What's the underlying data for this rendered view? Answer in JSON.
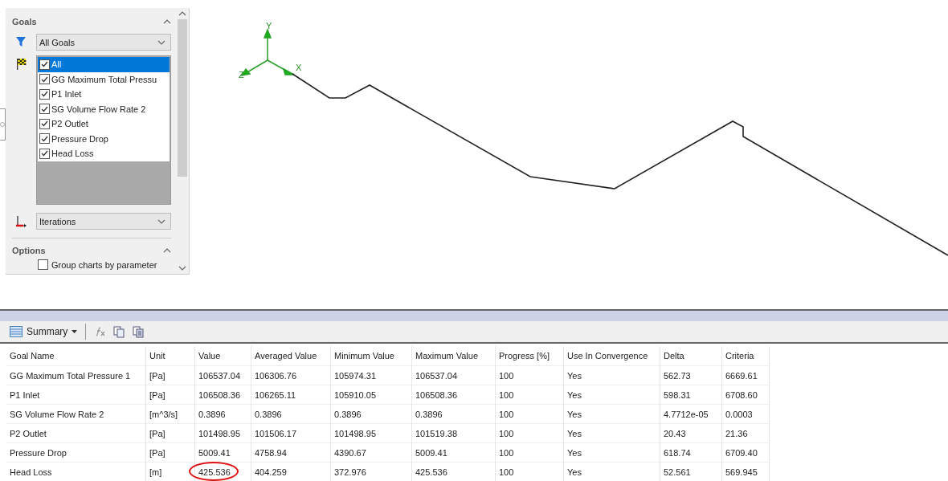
{
  "panel": {
    "section": "Goals",
    "filter": "All Goals",
    "goals": [
      {
        "label": "All",
        "checked": true,
        "selected": true
      },
      {
        "label": "GG Maximum Total Pressu",
        "checked": true,
        "selected": false
      },
      {
        "label": "P1 Inlet",
        "checked": true,
        "selected": false
      },
      {
        "label": "SG Volume Flow Rate 2",
        "checked": true,
        "selected": false
      },
      {
        "label": "P2 Outlet",
        "checked": true,
        "selected": false
      },
      {
        "label": "Pressure Drop",
        "checked": true,
        "selected": false
      },
      {
        "label": "Head Loss",
        "checked": true,
        "selected": false
      }
    ],
    "x_axis": "Iterations",
    "options_section": "Options",
    "options": [
      {
        "label": "Group charts by parameter",
        "checked": false
      }
    ]
  },
  "triad": {
    "y": "Y",
    "z": "Z",
    "x": "X"
  },
  "results": {
    "view": "Summary",
    "columns": [
      "Goal Name",
      "Unit",
      "Value",
      "Averaged Value",
      "Minimum Value",
      "Maximum Value",
      "Progress [%]",
      "Use In Convergence",
      "Delta",
      "Criteria"
    ],
    "rows": [
      {
        "cells": [
          "GG Maximum Total Pressure 1",
          "[Pa]",
          "106537.04",
          "106306.76",
          "105974.31",
          "106537.04",
          "100",
          "Yes",
          "562.73",
          "6669.61"
        ],
        "circled_value": false
      },
      {
        "cells": [
          "P1 Inlet",
          "[Pa]",
          "106508.36",
          "106265.11",
          "105910.05",
          "106508.36",
          "100",
          "Yes",
          "598.31",
          "6708.60"
        ],
        "circled_value": false
      },
      {
        "cells": [
          "SG Volume Flow Rate 2",
          "[m^3/s]",
          "0.3896",
          "0.3896",
          "0.3896",
          "0.3896",
          "100",
          "Yes",
          "4.7712e-05",
          "0.0003"
        ],
        "circled_value": false
      },
      {
        "cells": [
          "P2 Outlet",
          "[Pa]",
          "101498.95",
          "101506.17",
          "101498.95",
          "101519.38",
          "100",
          "Yes",
          "20.43",
          "21.36"
        ],
        "circled_value": false
      },
      {
        "cells": [
          "Pressure Drop",
          "[Pa]",
          "5009.41",
          "4758.94",
          "4390.67",
          "5009.41",
          "100",
          "Yes",
          "618.74",
          "6709.40"
        ],
        "circled_value": false
      },
      {
        "cells": [
          "Head Loss",
          "[m]",
          "425.536",
          "404.259",
          "372.976",
          "425.536",
          "100",
          "Yes",
          "52.561",
          "569.945"
        ],
        "circled_value": true
      }
    ]
  }
}
